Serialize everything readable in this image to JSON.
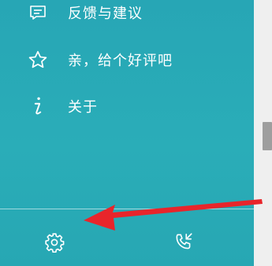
{
  "menu": {
    "items": [
      {
        "label": "反馈与建议",
        "icon": "feedback-icon"
      },
      {
        "label": "亲，给个好评吧",
        "icon": "star-icon"
      },
      {
        "label": "关于",
        "icon": "info-icon"
      }
    ]
  },
  "bottom_bar": {
    "settings_icon": "gear-icon",
    "call_icon": "phone-call-icon"
  },
  "annotation": {
    "arrow_color": "#e8252b"
  },
  "colors": {
    "drawer_bg": "#2aadb8",
    "text": "#ffffff"
  }
}
